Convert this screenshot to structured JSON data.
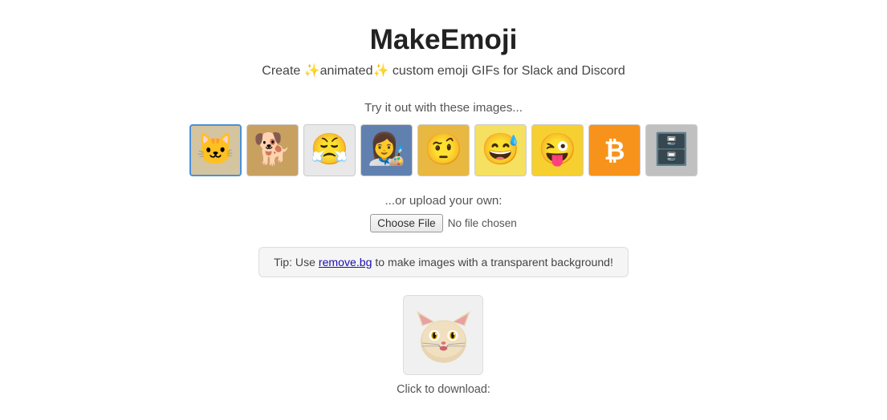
{
  "header": {
    "title": "MakeEmoji",
    "subtitle_prefix": "Create ",
    "subtitle_sparkle": "✨",
    "subtitle_animated": "animated",
    "subtitle_middle": " custom emoji GIFs for Slack and Discord"
  },
  "sample_section": {
    "label": "Try it out with these images...",
    "images": [
      {
        "id": "cat",
        "emoji": "🐱",
        "bg": "#d4c4a0",
        "selected": true,
        "alt": "Cat face"
      },
      {
        "id": "doge",
        "emoji": "🐶",
        "bg": "#c8a060",
        "selected": false,
        "alt": "Doge"
      },
      {
        "id": "troll",
        "emoji": "😤",
        "bg": "#e0e0e0",
        "selected": false,
        "alt": "Troll face"
      },
      {
        "id": "lady",
        "emoji": "👩",
        "bg": "#5070a0",
        "selected": false,
        "alt": "Lady painting"
      },
      {
        "id": "sneaky",
        "emoji": "🤔",
        "bg": "#e8b840",
        "selected": false,
        "alt": "Sneaky emoji"
      },
      {
        "id": "cry_laugh",
        "emoji": "😅",
        "bg": "#f5c842",
        "selected": false,
        "alt": "Cry laugh emoji"
      },
      {
        "id": "wink",
        "emoji": "😜",
        "bg": "#f0c030",
        "selected": false,
        "alt": "Wink emoji"
      },
      {
        "id": "bitcoin",
        "emoji": "₿",
        "bg": "#f7931a",
        "selected": false,
        "alt": "Bitcoin"
      },
      {
        "id": "database",
        "emoji": "🗄️",
        "bg": "#b0b0b0",
        "selected": false,
        "alt": "Database"
      }
    ]
  },
  "upload_section": {
    "label": "...or upload your own:",
    "button_label": "Choose File",
    "no_file_text": "No file chosen"
  },
  "tip_section": {
    "text_before": "Tip: Use ",
    "link_text": "remove.bg",
    "link_url": "https://www.remove.bg",
    "text_after": " to make images with a transparent background!"
  },
  "preview_section": {
    "download_label": "Click to download:"
  },
  "colors": {
    "accent": "#4a90d9",
    "title": "#222222",
    "subtitle": "#444444"
  }
}
